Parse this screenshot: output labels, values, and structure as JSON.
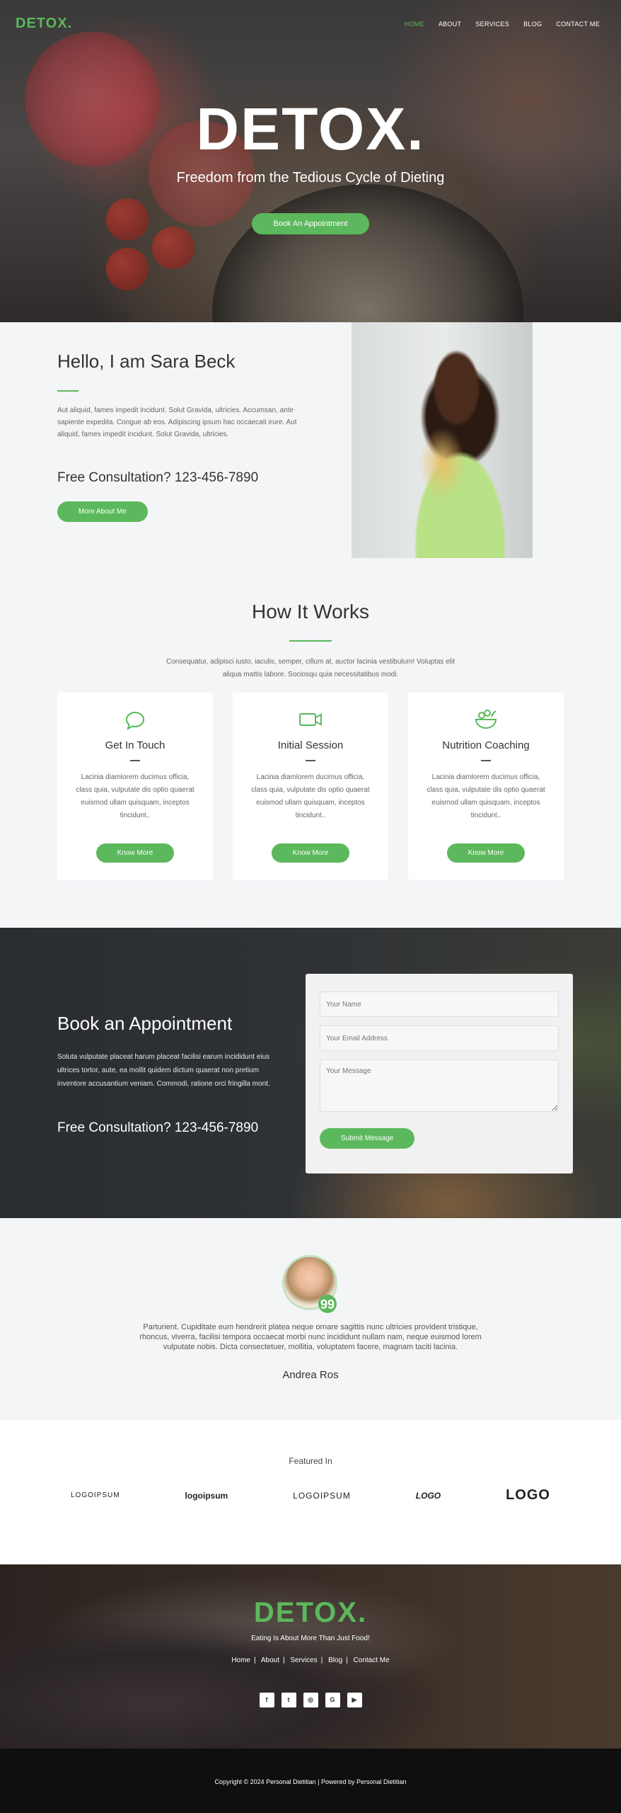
{
  "nav": {
    "logo": "DETOX.",
    "items": [
      "HOME",
      "ABOUT",
      "SERVICES",
      "BLOG",
      "CONTACT ME"
    ],
    "active": "HOME"
  },
  "hero": {
    "logo": "DETOX.",
    "subtitle": "Freedom from the Tedious Cycle of Dieting",
    "cta": "Book An Appointment"
  },
  "about": {
    "title": "Hello, I am Sara Beck",
    "body": "Aut aliquid, fames impedit incidunt. Solut Gravida, ultricies. Accumsan, ante sapiente expedita. Congue ab eos. Adipiscing ipsum hac occaecati irure. Aut aliquid, fames impedit incidunt. Solut Gravida, ultricies.",
    "phone": "Free Consultation? 123-456-7890",
    "cta": "More About Me"
  },
  "how": {
    "title": "How It Works",
    "lead": "Consequatur, adipisci iusto, iaculis, semper, cillum at, auctor lacinia vestibulum! Voluptas elit aliqua mattis labore. Sociosqu quia necessitatibus modi.",
    "cards": [
      {
        "icon": "chat-bubble-icon",
        "title": "Get In Touch",
        "body": "Lacinia diamlorem ducimus officia, class quia, vulputate dis optio quaerat euismod ullam quisquam, inceptos tincidunt..",
        "cta": "Know More"
      },
      {
        "icon": "video-camera-icon",
        "title": "Initial Session",
        "body": "Lacinia diamlorem ducimus officia, class quia, vulputate dis optio quaerat euismod ullam quisquam, inceptos tincidunt..",
        "cta": "Know More"
      },
      {
        "icon": "salad-bowl-icon",
        "title": "Nutrition Coaching",
        "body": "Lacinia diamlorem ducimus officia, class quia, vulputate dis optio quaerat euismod ullam quisquam, inceptos tincidunt..",
        "cta": "Know More"
      }
    ]
  },
  "appointment": {
    "title": "Book an Appointment",
    "body": "Soluta vulputate placeat harum placeat facilisi earum incididunt eius ultrices tortor, aute, ea mollit quidem dictum quaerat non pretium inventore accusantium veniam. Commodi, ratione orci fringilla mont.",
    "phone": "Free Consultation? 123-456-7890",
    "form": {
      "name_placeholder": "Your Name",
      "email_placeholder": "Your Email Address",
      "message_placeholder": "Your Message",
      "submit": "Submit Message"
    }
  },
  "testimonial": {
    "quote": "Parturient. Cupiditate eum hendrerit platea neque ornare sagittis nunc ultricies provident tristique, rhoncus, viverra, facilisi tempora occaecat morbi nunc incididunt nullam nam, neque euismod lorem vulputate nobis. Dicta consectetuer, mollitia, voluptatem facere, magnam taciti lacinia.",
    "author": "Andrea Ros",
    "badge": "99"
  },
  "featured": {
    "title": "Featured In",
    "logos": [
      "LOGOIPSUM",
      "logoipsum",
      "LOGOIPSUM",
      "LOGO",
      "LOGO"
    ]
  },
  "footer": {
    "logo": "DETOX.",
    "tagline": "Eating Is About More Than Just Food!",
    "links": [
      "Home",
      "About",
      "Services",
      "Blog",
      "Contact Me"
    ],
    "socials": [
      "facebook-icon",
      "twitter-icon",
      "instagram-icon",
      "google-icon",
      "youtube-icon"
    ],
    "copyright": "Copyright © 2024 Personal Dietitian | Powered by Personal Dietitian"
  },
  "colors": {
    "accent": "#5cb85c",
    "dark": "#0f0f10",
    "light_bg": "#f4f5f7"
  }
}
